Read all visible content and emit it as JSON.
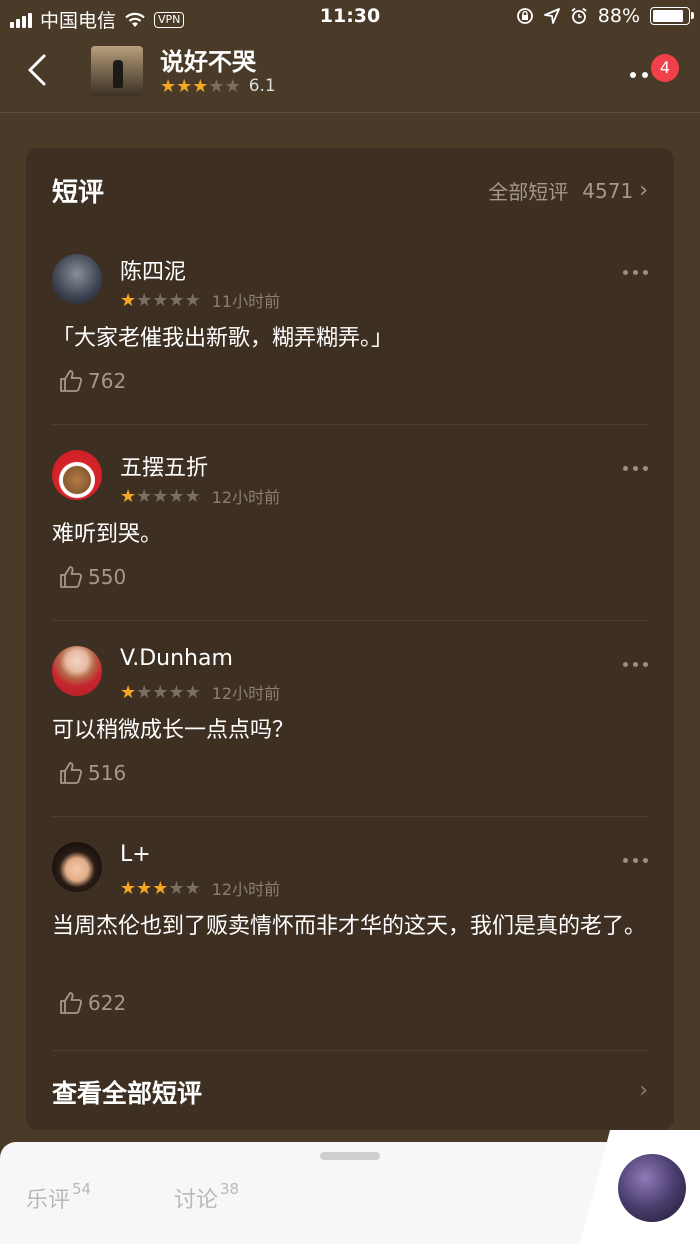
{
  "status_bar": {
    "carrier": "中国电信",
    "vpn": "VPN",
    "time": "11:30",
    "battery_pct": "88%",
    "battery_level": 0.88
  },
  "header": {
    "title": "说好不哭",
    "rating_stars": 3,
    "score": "6.1",
    "notification_count": "4"
  },
  "section": {
    "title": "短评",
    "all_label": "全部短评",
    "all_count": "4571",
    "see_all": "查看全部短评"
  },
  "reviews": [
    {
      "name": "陈四泥",
      "stars": 1,
      "time": "11小时前",
      "text": "「大家老催我出新歌，糊弄糊弄。」",
      "likes": "762"
    },
    {
      "name": "五摆五折",
      "stars": 1,
      "time": "12小时前",
      "text": "难听到哭。",
      "likes": "550"
    },
    {
      "name": "V.Dunham",
      "stars": 1,
      "time": "12小时前",
      "text": "可以稍微成长一点点吗？",
      "likes": "516"
    },
    {
      "name": "L+",
      "stars": 3,
      "time": "12小时前",
      "text": "当周杰伦也到了贩卖情怀而非才华的这天，我们是真的老了。",
      "likes": "622"
    }
  ],
  "bottom": {
    "tabs": [
      {
        "label": "乐评",
        "count": "54"
      },
      {
        "label": "讨论",
        "count": "38"
      }
    ]
  },
  "colors": {
    "background": "#4a3a28",
    "card": "#3d3023",
    "star_on": "#f5a623",
    "badge": "#f0414a"
  }
}
